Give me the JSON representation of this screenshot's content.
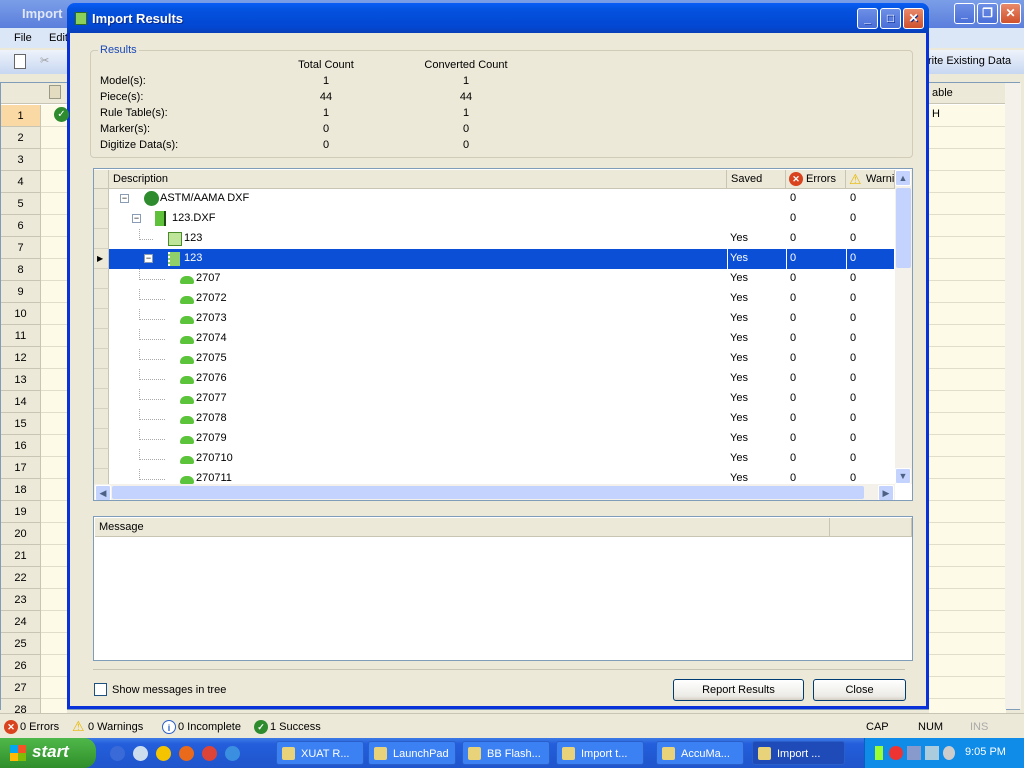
{
  "app": {
    "title": "Import",
    "menu": [
      "File",
      "Edit"
    ],
    "toolbar_overwrite": "rite Existing Data",
    "grid_col_right": "able",
    "grid_cell_right": "H",
    "row_numbers": [
      "1",
      "2",
      "3",
      "4",
      "5",
      "6",
      "7",
      "8",
      "9",
      "10",
      "11",
      "12",
      "13",
      "14",
      "15",
      "16",
      "17",
      "18",
      "19",
      "20",
      "21",
      "22",
      "23",
      "24",
      "25",
      "26",
      "27",
      "28"
    ]
  },
  "dialog": {
    "title": "Import Results",
    "results": {
      "legend": "Results",
      "col_total": "Total Count",
      "col_converted": "Converted Count",
      "rows": [
        {
          "label": "Model(s):",
          "total": "1",
          "converted": "1"
        },
        {
          "label": "Piece(s):",
          "total": "44",
          "converted": "44"
        },
        {
          "label": "Rule Table(s):",
          "total": "1",
          "converted": "1"
        },
        {
          "label": "Marker(s):",
          "total": "0",
          "converted": "0"
        },
        {
          "label": "Digitize Data(s):",
          "total": "0",
          "converted": "0"
        }
      ]
    },
    "tree": {
      "headers": {
        "description": "Description",
        "saved": "Saved",
        "errors": "Errors",
        "warnings": "Warnii"
      },
      "rows": [
        {
          "level": 0,
          "icon": "check-icon",
          "text": "ASTM/AAMA DXF",
          "saved": "",
          "errors": "0",
          "warnings": "0",
          "expander": true
        },
        {
          "level": 1,
          "icon": "file-icon",
          "text": "123.DXF",
          "saved": "",
          "errors": "0",
          "warnings": "0",
          "expander": true
        },
        {
          "level": 2,
          "icon": "rule-table-icon",
          "text": "123",
          "saved": "Yes",
          "errors": "0",
          "warnings": "0"
        },
        {
          "level": 2,
          "icon": "model-icon",
          "text": "123",
          "saved": "Yes",
          "errors": "0",
          "warnings": "0",
          "expander": true,
          "selected": true
        },
        {
          "level": 3,
          "icon": "piece-icon",
          "text": "2707",
          "saved": "Yes",
          "errors": "0",
          "warnings": "0"
        },
        {
          "level": 3,
          "icon": "piece-icon",
          "text": "27072",
          "saved": "Yes",
          "errors": "0",
          "warnings": "0"
        },
        {
          "level": 3,
          "icon": "piece-icon",
          "text": "27073",
          "saved": "Yes",
          "errors": "0",
          "warnings": "0"
        },
        {
          "level": 3,
          "icon": "piece-icon",
          "text": "27074",
          "saved": "Yes",
          "errors": "0",
          "warnings": "0"
        },
        {
          "level": 3,
          "icon": "piece-icon",
          "text": "27075",
          "saved": "Yes",
          "errors": "0",
          "warnings": "0"
        },
        {
          "level": 3,
          "icon": "piece-icon",
          "text": "27076",
          "saved": "Yes",
          "errors": "0",
          "warnings": "0"
        },
        {
          "level": 3,
          "icon": "piece-icon",
          "text": "27077",
          "saved": "Yes",
          "errors": "0",
          "warnings": "0"
        },
        {
          "level": 3,
          "icon": "piece-icon",
          "text": "27078",
          "saved": "Yes",
          "errors": "0",
          "warnings": "0"
        },
        {
          "level": 3,
          "icon": "piece-icon",
          "text": "27079",
          "saved": "Yes",
          "errors": "0",
          "warnings": "0"
        },
        {
          "level": 3,
          "icon": "piece-icon",
          "text": "270710",
          "saved": "Yes",
          "errors": "0",
          "warnings": "0"
        },
        {
          "level": 3,
          "icon": "piece-icon",
          "text": "270711",
          "saved": "Yes",
          "errors": "0",
          "warnings": "0"
        }
      ]
    },
    "message": {
      "header": "Message"
    },
    "show_messages_label": "Show messages in tree",
    "show_messages_checked": false,
    "report_button": "Report Results",
    "close_button": "Close"
  },
  "status": {
    "errors": "0 Errors",
    "warnings": "0 Warnings",
    "incomplete": "0 Incomplete",
    "success": "1 Success",
    "cap": "CAP",
    "num": "NUM",
    "ins": "INS"
  },
  "taskbar": {
    "start": "start",
    "tasks": [
      "XUAT R...",
      "LaunchPad",
      "BB Flash...",
      "Import t...",
      "AccuMa...",
      "Import ..."
    ],
    "active_task": 5,
    "clock": "9:05 PM"
  },
  "colors": {
    "selection": "#0a4fd6",
    "title_bar": "#0453e0",
    "error": "#d9431e",
    "success": "#2e8b2e"
  }
}
